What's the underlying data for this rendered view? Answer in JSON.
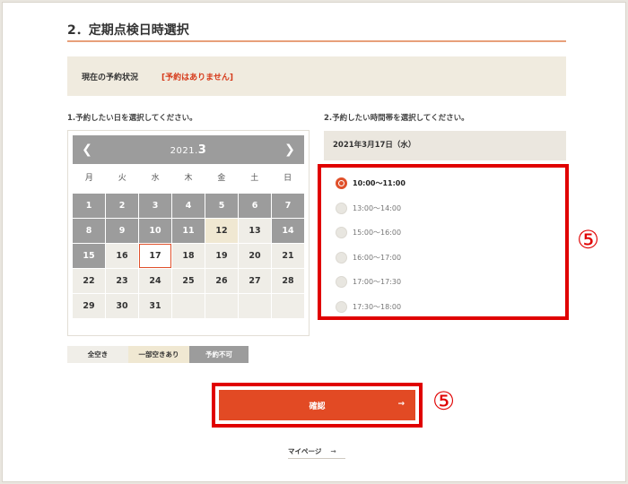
{
  "section": {
    "title": "2．定期点検日時選択"
  },
  "status": {
    "label": "現在の予約状況",
    "value": "[予約はありません]"
  },
  "calendar": {
    "step_label": "1.予約したい日を選択してください。",
    "year": "2021.",
    "month": "3",
    "weekdays": [
      "月",
      "火",
      "水",
      "木",
      "金",
      "土",
      "日"
    ],
    "days": [
      {
        "d": "1",
        "s": "full"
      },
      {
        "d": "2",
        "s": "full"
      },
      {
        "d": "3",
        "s": "full"
      },
      {
        "d": "4",
        "s": "full"
      },
      {
        "d": "5",
        "s": "full"
      },
      {
        "d": "6",
        "s": "full"
      },
      {
        "d": "7",
        "s": "full"
      },
      {
        "d": "8",
        "s": "full"
      },
      {
        "d": "9",
        "s": "full"
      },
      {
        "d": "10",
        "s": "full"
      },
      {
        "d": "11",
        "s": "full"
      },
      {
        "d": "12",
        "s": "partial"
      },
      {
        "d": "13",
        "s": "open"
      },
      {
        "d": "14",
        "s": "full"
      },
      {
        "d": "15",
        "s": "full"
      },
      {
        "d": "16",
        "s": "open"
      },
      {
        "d": "17",
        "s": "selected"
      },
      {
        "d": "18",
        "s": "open"
      },
      {
        "d": "19",
        "s": "open"
      },
      {
        "d": "20",
        "s": "open"
      },
      {
        "d": "21",
        "s": "open"
      },
      {
        "d": "22",
        "s": "open"
      },
      {
        "d": "23",
        "s": "open"
      },
      {
        "d": "24",
        "s": "open"
      },
      {
        "d": "25",
        "s": "open"
      },
      {
        "d": "26",
        "s": "open"
      },
      {
        "d": "27",
        "s": "open"
      },
      {
        "d": "28",
        "s": "open"
      },
      {
        "d": "29",
        "s": "open"
      },
      {
        "d": "30",
        "s": "open"
      },
      {
        "d": "31",
        "s": "open"
      },
      {
        "d": "",
        "s": "empty"
      },
      {
        "d": "",
        "s": "empty"
      },
      {
        "d": "",
        "s": "empty"
      },
      {
        "d": "",
        "s": "empty"
      }
    ],
    "prev_icon": "chevron-left-icon",
    "next_icon": "chevron-right-icon"
  },
  "legend": {
    "open": "全空き",
    "partial": "一部空きあり",
    "unavailable": "予約不可"
  },
  "timeslots": {
    "step_label": "2.予約したい時間帯を選択してください。",
    "date": "2021年3月17日（水）",
    "slots": [
      {
        "label": "10:00～11:00",
        "checked": true
      },
      {
        "label": "13:00～14:00",
        "checked": false
      },
      {
        "label": "15:00～16:00",
        "checked": false
      },
      {
        "label": "16:00～17:00",
        "checked": false
      },
      {
        "label": "17:00～17:30",
        "checked": false
      },
      {
        "label": "17:30～18:00",
        "checked": false
      }
    ]
  },
  "markers": {
    "slots": "⑤",
    "confirm": "⑤"
  },
  "confirm": {
    "label": "確認",
    "arrow": "→"
  },
  "mypage": {
    "label": "マイページ",
    "arrow": "→"
  },
  "colors": {
    "accent": "#e24a24",
    "highlight": "#e00000",
    "full": "#9c9c9c",
    "partial": "#f0e8d2"
  }
}
